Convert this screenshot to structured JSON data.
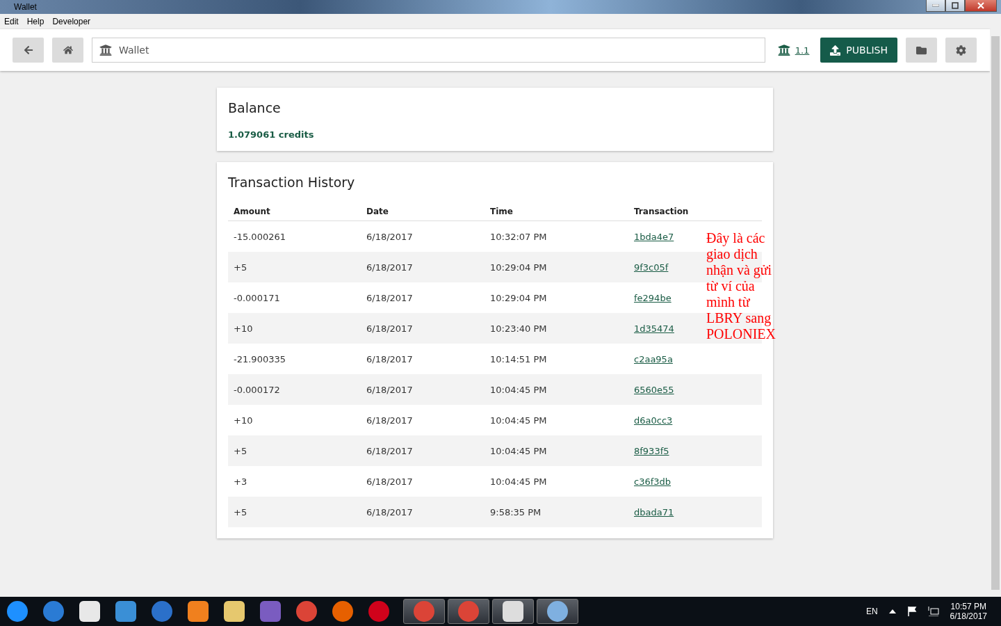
{
  "window": {
    "title": "Wallet"
  },
  "menu": [
    "Edit",
    "Help",
    "Developer"
  ],
  "header": {
    "address": "Wallet",
    "balance_link": "1.1",
    "publish_button": "PUBLISH"
  },
  "balance": {
    "title": "Balance",
    "amount": "1.079061 credits"
  },
  "history": {
    "title": "Transaction History",
    "columns": [
      "Amount",
      "Date",
      "Time",
      "Transaction"
    ],
    "rows": [
      {
        "amount": "-15.000261",
        "date": "6/18/2017",
        "time": "10:32:07 PM",
        "transaction": "1bda4e7"
      },
      {
        "amount": "+5",
        "date": "6/18/2017",
        "time": "10:29:04 PM",
        "transaction": "9f3c05f"
      },
      {
        "amount": "-0.000171",
        "date": "6/18/2017",
        "time": "10:29:04 PM",
        "transaction": "fe294be"
      },
      {
        "amount": "+10",
        "date": "6/18/2017",
        "time": "10:23:40 PM",
        "transaction": "1d35474"
      },
      {
        "amount": "-21.900335",
        "date": "6/18/2017",
        "time": "10:14:51 PM",
        "transaction": "c2aa95a"
      },
      {
        "amount": "-0.000172",
        "date": "6/18/2017",
        "time": "10:04:45 PM",
        "transaction": "6560e55"
      },
      {
        "amount": "+10",
        "date": "6/18/2017",
        "time": "10:04:45 PM",
        "transaction": "d6a0cc3"
      },
      {
        "amount": "+5",
        "date": "6/18/2017",
        "time": "10:04:45 PM",
        "transaction": "8f933f5"
      },
      {
        "amount": "+3",
        "date": "6/18/2017",
        "time": "10:04:45 PM",
        "transaction": "c36f3db"
      },
      {
        "amount": "+5",
        "date": "6/18/2017",
        "time": "9:58:35 PM",
        "transaction": "dbada71"
      }
    ]
  },
  "annotation": "Đây là các giao dịch nhận và gửi từ ví của mình từ LBRY sang POLONIEX",
  "taskbar": {
    "language": "EN",
    "time": "10:57 PM",
    "date": "6/18/2017"
  }
}
